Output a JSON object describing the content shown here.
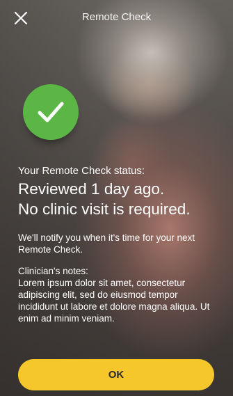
{
  "header": {
    "title": "Remote Check",
    "close_icon": "close-icon"
  },
  "badge": {
    "icon": "checkmark-icon",
    "color": "#5bb646"
  },
  "status": {
    "label": "Your Remote Check status:",
    "line1": "Reviewed 1 day ago.",
    "line2": "No clinic visit is required."
  },
  "notify_text": "We'll notify you when it's time for your next Remote Check.",
  "notes": {
    "label": "Clinician's notes:",
    "body": "Lorem ipsum dolor sit amet, consectetur adipiscing elit, sed do eiusmod tempor incididunt ut labore et dolore magna aliqua. Ut enim ad minim veniam."
  },
  "actions": {
    "ok_label": "OK",
    "button_color": "#f5c72a"
  }
}
